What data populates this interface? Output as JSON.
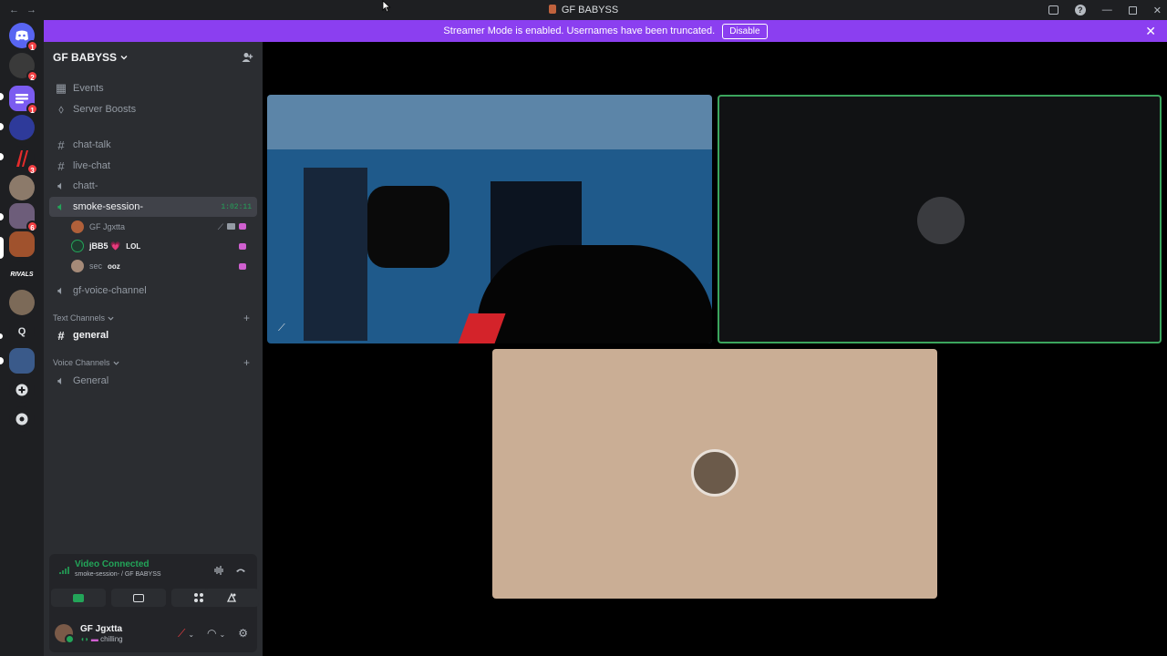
{
  "window": {
    "title": "GF BABYSS",
    "back_label": "←",
    "forward_label": "→",
    "help_label": "?",
    "minimize_label": "—",
    "close_label": "✕"
  },
  "guild_badges": [
    "1",
    "2",
    "1",
    "3",
    "6"
  ],
  "guild_letter": "Q",
  "streamer_banner": {
    "text": "Streamer Mode is enabled. Usernames have been truncated.",
    "button": "Disable",
    "close": "✕"
  },
  "server": {
    "name": "GF BABYSS",
    "menu": [
      {
        "label": "Events",
        "icon": "calendar-icon"
      },
      {
        "label": "Server Boosts",
        "icon": "boost-icon"
      }
    ],
    "channels": [
      {
        "name": "chat-talk",
        "type": "text"
      },
      {
        "name": "live-chat",
        "type": "text"
      },
      {
        "name": "chatt-",
        "type": "voice"
      },
      {
        "name": "smoke-session-",
        "type": "voice",
        "active": true,
        "timer": "1:02:11"
      },
      {
        "name": "gf-voice-channel",
        "type": "voice"
      }
    ],
    "voice_users": [
      {
        "name": "GF Jgxtta",
        "tag": ""
      },
      {
        "name": "jBB5 💗",
        "tag": "LOL"
      },
      {
        "name": "sec",
        "tag": "ooz"
      }
    ],
    "categories": [
      {
        "label": "Text Channels",
        "channels": [
          "general"
        ]
      },
      {
        "label": "Voice Channels",
        "channels": [
          "General"
        ]
      }
    ]
  },
  "voice_panel": {
    "status": "Video Connected",
    "location": "smoke-session- / GF BABYSS"
  },
  "user": {
    "name": "GF Jgxtta",
    "status": "chilling"
  },
  "colors": {
    "accent": "#8b3ff0",
    "connected": "#23a559",
    "speaking_border": "#3ba55d",
    "mute_red": "#f23f43"
  }
}
